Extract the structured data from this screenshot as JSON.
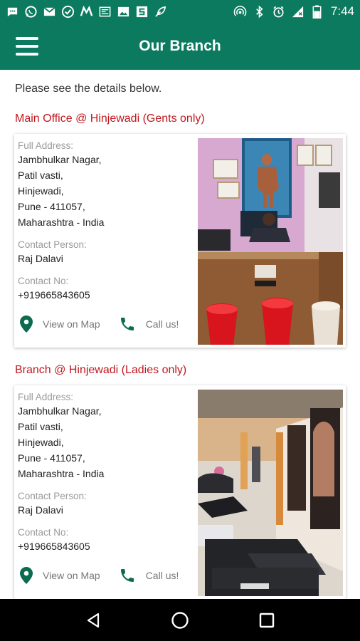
{
  "status_bar": {
    "time": "7:44",
    "left_icons": [
      "chat-icon",
      "whatsapp-icon",
      "gmail-icon",
      "check-circle-icon",
      "m-icon",
      "news-icon",
      "image-icon",
      "s-app-icon",
      "spa-icon"
    ],
    "right_icons": [
      "hotspot-icon",
      "bluetooth-icon",
      "alarm-icon",
      "signal-icon",
      "battery-icon"
    ]
  },
  "app_bar": {
    "title": "Our Branch",
    "menu_icon": "hamburger-menu-icon"
  },
  "intro": "Please see the details below.",
  "branches": [
    {
      "title": "Main Office @ Hinjewadi (Gents only)",
      "address_label": "Full Address:",
      "address_lines": [
        "Jambhulkar Nagar,",
        "Patil vasti,",
        "Hinjewadi,",
        "Pune - 411057,",
        "Maharashtra - India"
      ],
      "contact_label": "Contact Person:",
      "contact_person": "Raj Dalavi",
      "phone_label": "Contact No:",
      "phone": "+919665843605",
      "map_label": "View on Map",
      "call_label": "Call us!",
      "photo": "gym-reception-photo"
    },
    {
      "title": "Branch @ Hinjewadi (Ladies only)",
      "address_label": "Full Address:",
      "address_lines": [
        "Jambhulkar Nagar,",
        "Patil vasti,",
        "Hinjewadi,",
        "Pune - 411057,",
        "Maharashtra - India"
      ],
      "contact_label": "Contact Person:",
      "contact_person": "Raj Dalavi",
      "phone_label": "Contact No:",
      "phone": "+919665843605",
      "map_label": "View on Map",
      "call_label": "Call us!",
      "photo": "gym-treadmill-photo"
    }
  ],
  "nav_bar": {
    "buttons": [
      "back-icon",
      "home-icon",
      "recents-icon"
    ]
  },
  "colors": {
    "primary": "#0b7a5e",
    "branch_title": "#c0181f",
    "icon_green": "#0b6b4e"
  }
}
